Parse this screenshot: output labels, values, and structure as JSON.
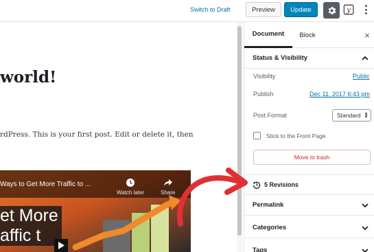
{
  "toolbar": {
    "switch_to_draft": "Switch to Draft",
    "preview": "Preview",
    "update": "Update",
    "settings_icon": "gear-icon",
    "yoast_icon": "yoast-icon",
    "more_icon": "more-vertical-icon",
    "yoast_glyph": "y"
  },
  "editor": {
    "title": "world!",
    "paragraph": "rdPress. This is your first post. Edit or delete it, then",
    "video": {
      "title": "Ways to Get More Traffic to ...",
      "watch_later": "Watch later",
      "share": "Share",
      "overlay_line1": "et More",
      "overlay_line2": "affic t"
    }
  },
  "sidebar": {
    "tabs": {
      "document": "Document",
      "block": "Block"
    },
    "close": "×",
    "status_visibility": {
      "header": "Status & Visibility",
      "visibility_label": "Visibility",
      "visibility_value": "Public",
      "publish_label": "Publish",
      "publish_value": "Dec 11, 2017 6:43 pm",
      "post_format_label": "Post Format",
      "post_format_value": "Standard",
      "stick_label": "Stick to the Front Page",
      "trash_button": "Move to trash"
    },
    "revisions": "5 Revisions",
    "panels": [
      "Permalink",
      "Categories",
      "Tags"
    ]
  },
  "colors": {
    "accent": "#0085ba",
    "link": "#0073aa",
    "danger": "#c4252a",
    "annotation": "#e03034"
  }
}
